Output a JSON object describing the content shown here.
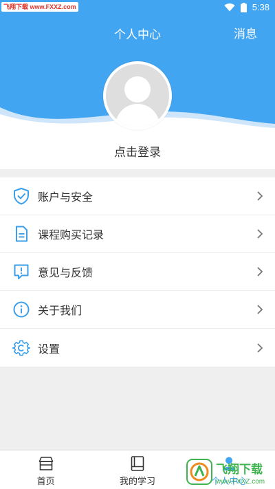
{
  "status_bar": {
    "watermark": "飞翔下载 www.FXXZ.com",
    "time": "5:38",
    "wifi_icon": "wifi-icon",
    "battery_icon": "battery-icon"
  },
  "header": {
    "title": "个人中心",
    "message_label": "消息"
  },
  "profile": {
    "login_label": "点击登录",
    "avatar_icon": "user-avatar-icon"
  },
  "menu": [
    {
      "label": "账户与安全",
      "icon": "shield-check-icon"
    },
    {
      "label": "课程购买记录",
      "icon": "document-icon"
    },
    {
      "label": "意见与反馈",
      "icon": "feedback-icon"
    },
    {
      "label": "关于我们",
      "icon": "info-icon"
    },
    {
      "label": "设置",
      "icon": "settings-gear-icon"
    }
  ],
  "tabs": [
    {
      "label": "首页",
      "icon": "home-icon",
      "active": false
    },
    {
      "label": "我的学习",
      "icon": "book-icon",
      "active": false
    },
    {
      "label": "个人中心",
      "icon": "person-icon",
      "active": true
    }
  ],
  "watermark_logo": {
    "text": "飞翔下载",
    "url": "www.FXXZ.com"
  },
  "colors": {
    "accent": "#41a5f2",
    "icon_blue": "#3b9fea",
    "background": "#efefef"
  }
}
